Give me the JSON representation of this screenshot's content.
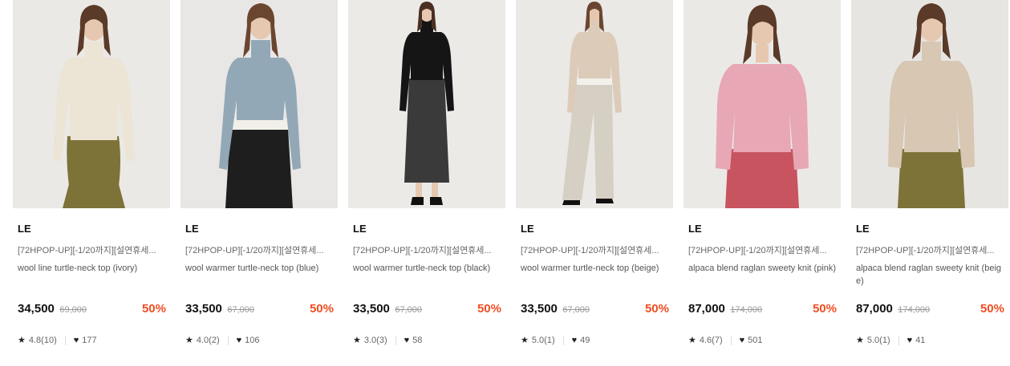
{
  "products": [
    {
      "brand": "LE",
      "promo": "[72HPOP-UP][-1/20까지][설연휴세...",
      "name": "wool line turtle-neck top (ivory)",
      "price": "34,500",
      "original_price": "69,000",
      "discount": "50%",
      "rating": "4.8(10)",
      "likes": "177",
      "colors": {
        "top": "#ece4d4",
        "bottom": "#7d7238",
        "hair": "#5a3a28",
        "bg": "#ebe9e6"
      }
    },
    {
      "brand": "LE",
      "promo": "[72HPOP-UP][-1/20까지][설연휴세...",
      "name": "wool warmer turtle-neck top (blue)",
      "price": "33,500",
      "original_price": "67,000",
      "discount": "50%",
      "rating": "4.0(2)",
      "likes": "106",
      "colors": {
        "top": "#93a8b6",
        "bottom": "#1e1e1e",
        "hair": "#6a4630",
        "bg": "#e8e7e5"
      }
    },
    {
      "brand": "LE",
      "promo": "[72HPOP-UP][-1/20까지][설연휴세...",
      "name": "wool warmer turtle-neck top (black)",
      "price": "33,500",
      "original_price": "67,000",
      "discount": "50%",
      "rating": "3.0(3)",
      "likes": "58",
      "colors": {
        "top": "#151515",
        "bottom": "#3a3a3b",
        "hair": "#4a3022",
        "bg": "#eceae7"
      }
    },
    {
      "brand": "LE",
      "promo": "[72HPOP-UP][-1/20까지][설연휴세...",
      "name": "wool warmer turtle-neck top (beige)",
      "price": "33,500",
      "original_price": "67,000",
      "discount": "50%",
      "rating": "5.0(1)",
      "likes": "49",
      "colors": {
        "top": "#dccbb9",
        "bottom": "#d6cfc3",
        "hair": "#6a4630",
        "bg": "#ebe9e6"
      }
    },
    {
      "brand": "LE",
      "promo": "[72HPOP-UP][-1/20까지][설연휴세...",
      "name": "alpaca blend raglan sweety knit (pink)",
      "price": "87,000",
      "original_price": "174,000",
      "discount": "50%",
      "rating": "4.6(7)",
      "likes": "501",
      "colors": {
        "top": "#e8a7b4",
        "bottom": "#c7545f",
        "hair": "#5a3a28",
        "bg": "#ebe9e6"
      }
    },
    {
      "brand": "LE",
      "promo": "[72HPOP-UP][-1/20까지][설연휴세...",
      "name": "alpaca blend raglan sweety knit (beige)",
      "price": "87,000",
      "original_price": "174,000",
      "discount": "50%",
      "rating": "5.0(1)",
      "likes": "41",
      "colors": {
        "top": "#d7c7b3",
        "bottom": "#7d7238",
        "hair": "#5a3a28",
        "bg": "#e7e5e1"
      }
    }
  ],
  "icons": {
    "rating": "star-icon",
    "likes": "heart-icon"
  },
  "accent_color": "#f04e23"
}
